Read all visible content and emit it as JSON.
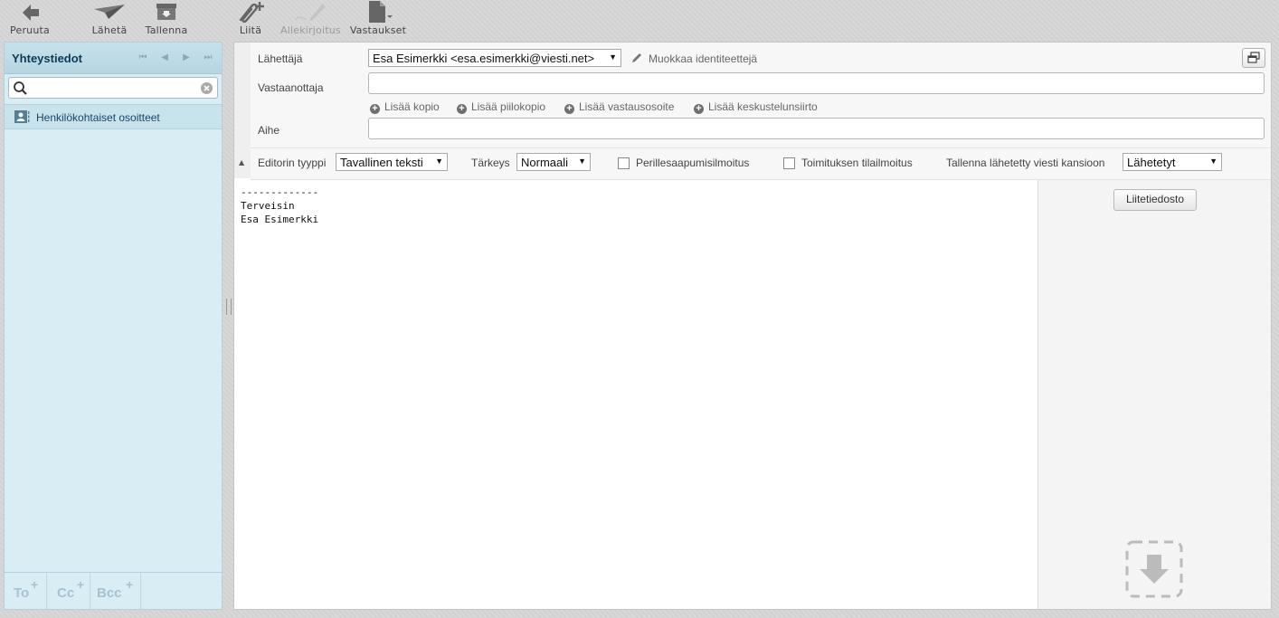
{
  "toolbar": {
    "cancel": "Peruuta",
    "send": "Lähetä",
    "save": "Tallenna",
    "attach": "Liitä",
    "signature": "Allekirjoitus",
    "responses": "Vastaukset"
  },
  "contacts": {
    "title": "Yhteystiedot",
    "search_value": "",
    "address_book": "Henkilökohtaiset osoitteet",
    "footer": {
      "to": "To",
      "cc": "Cc",
      "bcc": "Bcc",
      "plus": "+"
    }
  },
  "compose": {
    "from_label": "Lähettäjä",
    "from_value": "Esa Esimerkki <esa.esimerkki@viesti.net>",
    "edit_identities": "Muokkaa identiteettejä",
    "to_label": "Vastaanottaja",
    "to_value": "",
    "add_cc": "Lisää kopio",
    "add_bcc": "Lisää piilokopio",
    "add_reply_to": "Lisää vastausosoite",
    "add_followup_to": "Lisää keskustelunsiirto",
    "subject_label": "Aihe",
    "subject_value": ""
  },
  "options": {
    "editor_type_label": "Editorin tyyppi",
    "editor_type_value": "Tavallinen teksti",
    "priority_label": "Tärkeys",
    "priority_value": "Normaali",
    "delivery_receipt": "Perillesaapumisilmoitus",
    "return_receipt": "Toimituksen tilailmoitus",
    "save_sent_label": "Tallenna lähetetty viesti kansioon",
    "save_sent_value": "Lähetetyt"
  },
  "body": {
    "text": "-------------\nTerveisin\nEsa Esimerkki"
  },
  "attachments": {
    "button": "Liitetiedosto"
  },
  "icons": {
    "back": "arrow-left-icon",
    "send": "paper-plane-icon",
    "save": "save-box-icon",
    "attach": "paperclip-icon",
    "signature": "pen-icon",
    "responses": "document-icon",
    "search": "search-icon",
    "clear": "clear-icon",
    "contact": "contact-card-icon",
    "popout": "popout-icon",
    "drop": "drop-arrow-icon"
  }
}
